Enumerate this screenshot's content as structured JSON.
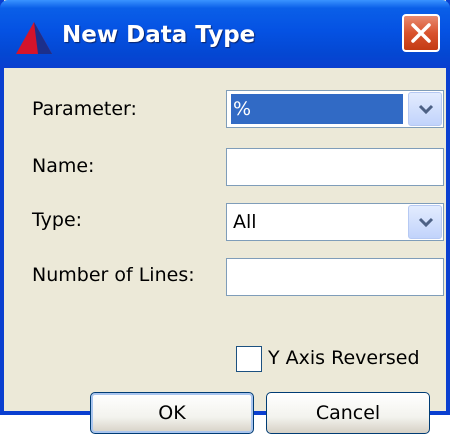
{
  "window": {
    "title": "New Data Type",
    "title_color": "#0447d2"
  },
  "form": {
    "parameter": {
      "label": "Parameter:",
      "value": "%"
    },
    "name": {
      "label": "Name:",
      "value": ""
    },
    "type": {
      "label": "Type:",
      "value": "All"
    },
    "number_of_lines": {
      "label": "Number of Lines:",
      "value": ""
    },
    "y_axis_reversed": {
      "label": "Y Axis Reversed",
      "checked": false
    }
  },
  "buttons": {
    "ok": "OK",
    "cancel": "Cancel"
  },
  "icons": {
    "app": "app-logo-icon",
    "close": "close-icon",
    "dropdown": "chevron-down-icon"
  },
  "colors": {
    "selection": "#316ac5",
    "close_button": "#d9532e",
    "dialog_bg": "#ece9d8"
  }
}
